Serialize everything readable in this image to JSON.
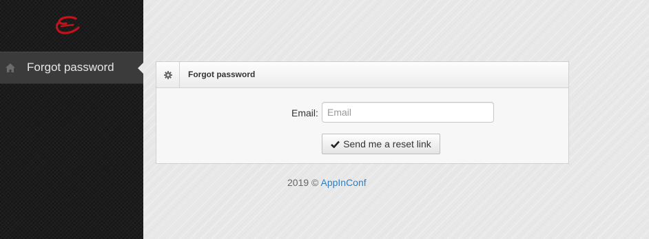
{
  "sidebar": {
    "nav_items": [
      {
        "label": "Forgot password",
        "icon": "home-icon"
      }
    ],
    "logo_color": "#c0141c"
  },
  "panel": {
    "title": "Forgot password",
    "icon": "gear-icon",
    "email_label": "Email:",
    "email_value": "",
    "email_placeholder": "Email",
    "submit_label": "Send me a reset link",
    "submit_icon": "checkmark-icon"
  },
  "footer": {
    "copyright": "2019 ©",
    "brand_link": "AppInConf",
    "link_color": "#2a7fc7"
  }
}
